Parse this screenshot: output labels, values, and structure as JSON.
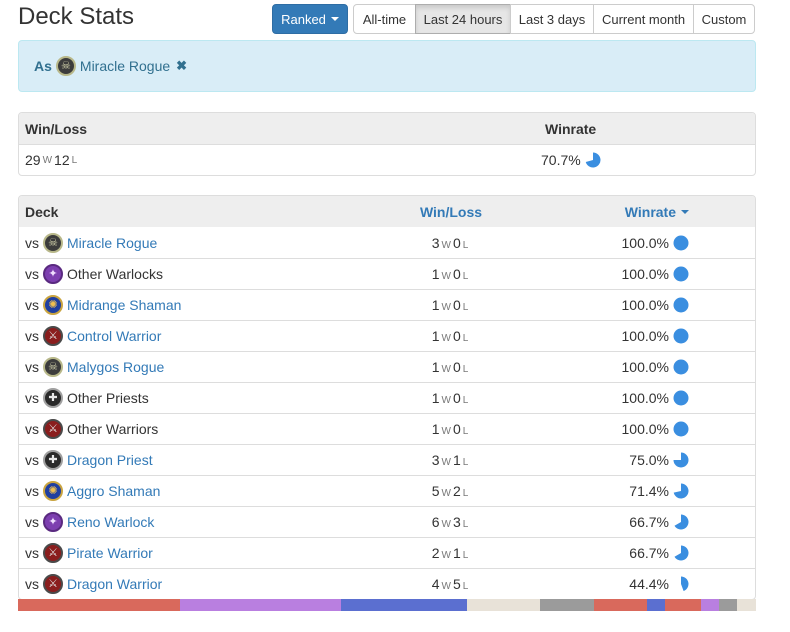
{
  "header": {
    "title": "Deck Stats"
  },
  "filters": {
    "mode_label": "Ranked",
    "ranges": [
      {
        "label": "All-time",
        "active": false
      },
      {
        "label": "Last 24 hours",
        "active": true
      },
      {
        "label": "Last 3 days",
        "active": false
      },
      {
        "label": "Current month",
        "active": false
      },
      {
        "label": "Custom",
        "active": false
      }
    ]
  },
  "selected_deck": {
    "prefix": "As",
    "name": "Miracle Rogue",
    "icon": "rogue-class-icon"
  },
  "summary": {
    "headers": {
      "winloss": "Win/Loss",
      "winrate": "Winrate"
    },
    "wins": "29",
    "losses": "12",
    "w_label": "W",
    "l_label": "L",
    "winrate": "70.7%",
    "winrate_fraction": 0.707
  },
  "matchups": {
    "headers": {
      "deck": "Deck",
      "winloss": "Win/Loss",
      "winrate": "Winrate"
    },
    "vs_label": "vs",
    "rows": [
      {
        "name": "Miracle Rogue",
        "icon": "rogue-class-icon",
        "link": true,
        "wins": "3",
        "losses": "0",
        "winrate": "100.0%",
        "fraction": 1.0
      },
      {
        "name": "Other Warlocks",
        "icon": "warlock-class-icon",
        "link": false,
        "wins": "1",
        "losses": "0",
        "winrate": "100.0%",
        "fraction": 1.0
      },
      {
        "name": "Midrange Shaman",
        "icon": "shaman-class-icon",
        "link": true,
        "wins": "1",
        "losses": "0",
        "winrate": "100.0%",
        "fraction": 1.0
      },
      {
        "name": "Control Warrior",
        "icon": "warrior-class-icon",
        "link": true,
        "wins": "1",
        "losses": "0",
        "winrate": "100.0%",
        "fraction": 1.0
      },
      {
        "name": "Malygos Rogue",
        "icon": "rogue-class-icon",
        "link": true,
        "wins": "1",
        "losses": "0",
        "winrate": "100.0%",
        "fraction": 1.0
      },
      {
        "name": "Other Priests",
        "icon": "priest-class-icon",
        "link": false,
        "wins": "1",
        "losses": "0",
        "winrate": "100.0%",
        "fraction": 1.0
      },
      {
        "name": "Other Warriors",
        "icon": "warrior-class-icon",
        "link": false,
        "wins": "1",
        "losses": "0",
        "winrate": "100.0%",
        "fraction": 1.0
      },
      {
        "name": "Dragon Priest",
        "icon": "priest-class-icon",
        "link": true,
        "wins": "3",
        "losses": "1",
        "winrate": "75.0%",
        "fraction": 0.75
      },
      {
        "name": "Aggro Shaman",
        "icon": "shaman-class-icon",
        "link": true,
        "wins": "5",
        "losses": "2",
        "winrate": "71.4%",
        "fraction": 0.714
      },
      {
        "name": "Reno Warlock",
        "icon": "warlock-class-icon",
        "link": true,
        "wins": "6",
        "losses": "3",
        "winrate": "66.7%",
        "fraction": 0.667
      },
      {
        "name": "Pirate Warrior",
        "icon": "warrior-class-icon",
        "link": true,
        "wins": "2",
        "losses": "1",
        "winrate": "66.7%",
        "fraction": 0.667
      },
      {
        "name": "Dragon Warrior",
        "icon": "warrior-class-icon",
        "link": true,
        "wins": "4",
        "losses": "5",
        "winrate": "44.4%",
        "fraction": 0.444
      }
    ]
  },
  "class_distribution": [
    {
      "class": "warrior",
      "fraction": 0.219,
      "color": "#d9695c"
    },
    {
      "class": "warlock",
      "fraction": 0.219,
      "color": "#b97fe0"
    },
    {
      "class": "shaman",
      "fraction": 0.171,
      "color": "#5b6fd0"
    },
    {
      "class": "priest",
      "fraction": 0.098,
      "color": "#e8e2d8"
    },
    {
      "class": "rogue",
      "fraction": 0.073,
      "color": "#9b9b9b"
    },
    {
      "class": "warrior",
      "fraction": 0.073,
      "color": "#d9695c"
    },
    {
      "class": "shaman",
      "fraction": 0.024,
      "color": "#5b6fd0"
    },
    {
      "class": "warrior",
      "fraction": 0.049,
      "color": "#d9695c"
    },
    {
      "class": "warlock",
      "fraction": 0.024,
      "color": "#b97fe0"
    },
    {
      "class": "rogue",
      "fraction": 0.024,
      "color": "#9b9b9b"
    },
    {
      "class": "priest",
      "fraction": 0.026,
      "color": "#e8e2d8"
    }
  ],
  "colors": {
    "pie": "#3a8ee0",
    "link": "#337ab7",
    "alert_bg": "#d9edf7"
  }
}
